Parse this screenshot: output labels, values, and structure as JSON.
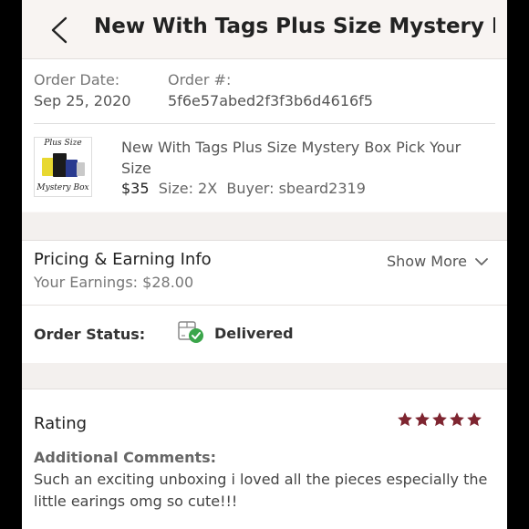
{
  "header": {
    "title": "New With Tags Plus Size Mystery B..."
  },
  "order": {
    "date_label": "Order Date:",
    "date_value": "Sep 25, 2020",
    "number_label": "Order #:",
    "number_value": "5f6e57abed2f3f3b6d4616f5"
  },
  "item": {
    "thumb_line1": "Plus Size",
    "thumb_line2": "Mystery Box",
    "title": "New With Tags Plus Size Mystery Box Pick Your Size",
    "price": "$35",
    "size": "Size: 2X",
    "buyer": "Buyer: sbeard2319"
  },
  "pricing": {
    "title": "Pricing & Earning Info",
    "earnings": "Your Earnings: $28.00",
    "show_more": "Show More"
  },
  "status": {
    "label": "Order Status:",
    "value": "Delivered"
  },
  "rating": {
    "title": "Rating",
    "stars": 5,
    "comments_label": "Additional Comments:",
    "comments_text": "Such an exciting unboxing i loved all the pieces especially the little earings omg so cute!!!"
  },
  "colors": {
    "star": "#7e2530",
    "check": "#3aa54a",
    "background": "#faf8f7"
  },
  "icons": [
    "chevron-left-icon",
    "chevron-down-icon",
    "package-delivered-icon",
    "star-icon"
  ]
}
